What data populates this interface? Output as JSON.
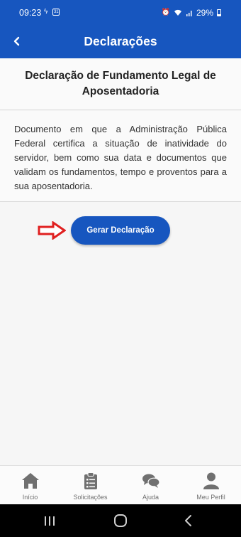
{
  "status_bar": {
    "time": "09:23",
    "calendar_day": "31",
    "battery_percent": "29%",
    "icons": [
      "flash-icon",
      "calendar-icon",
      "alarm-icon",
      "wifi-icon",
      "signal-icon",
      "battery-icon"
    ]
  },
  "app_bar": {
    "title": "Declarações",
    "back_icon": "chevron-left-icon"
  },
  "content": {
    "title": "Declaração de Fundamento Legal de Aposentadoria",
    "description": "Documento em que a Administração Pública Federal certifica a situação de inatividade do servidor, bem como sua data e documentos que validam os fundamentos, tempo e proventos para a sua aposentadoria.",
    "button_label": "Gerar Declaração",
    "arrow_icon": "right-arrow-icon"
  },
  "bottom_nav": {
    "items": [
      {
        "label": "Início",
        "icon": "home-icon"
      },
      {
        "label": "Solicitações",
        "icon": "clipboard-icon"
      },
      {
        "label": "Ajuda",
        "icon": "chat-bubbles-icon"
      },
      {
        "label": "Meu Perfil",
        "icon": "user-icon"
      }
    ]
  },
  "system_nav": {
    "icons": [
      "recent-apps-icon",
      "home-circle-icon",
      "back-icon"
    ]
  },
  "colors": {
    "primary": "#1756bf",
    "arrow": "#e02020",
    "nav_icon": "#707070"
  }
}
